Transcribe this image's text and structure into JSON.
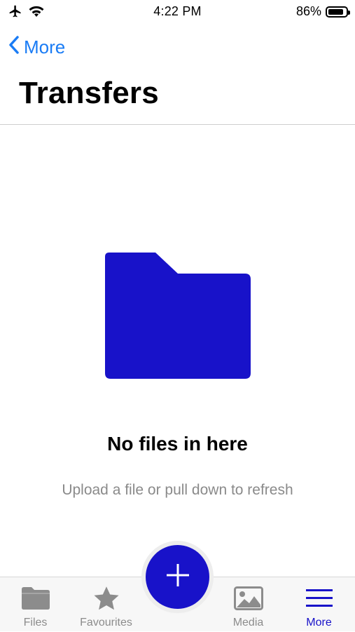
{
  "status_bar": {
    "time": "4:22 PM",
    "battery": "86%",
    "battery_level": 0.86,
    "icons": [
      "airplane-icon",
      "wifi-icon",
      "battery-icon"
    ]
  },
  "nav": {
    "back_label": "More",
    "title": "Transfers"
  },
  "empty_state": {
    "icon": "folder-icon",
    "title": "No files in here",
    "subtitle": "Upload a file or pull down to refresh"
  },
  "fab": {
    "icon": "plus-icon"
  },
  "tab_bar": {
    "tabs": [
      {
        "label": "Files",
        "icon": "folder-icon",
        "active": false
      },
      {
        "label": "Favourites",
        "icon": "star-icon",
        "active": false
      },
      {
        "label": "Media",
        "icon": "image-icon",
        "active": false
      },
      {
        "label": "More",
        "icon": "menu-icon",
        "active": true
      }
    ]
  },
  "colors": {
    "accent": "#1812c9",
    "link": "#1a7cf5",
    "inactive": "#8c8c8c",
    "subtitle": "#8a8a8a"
  }
}
